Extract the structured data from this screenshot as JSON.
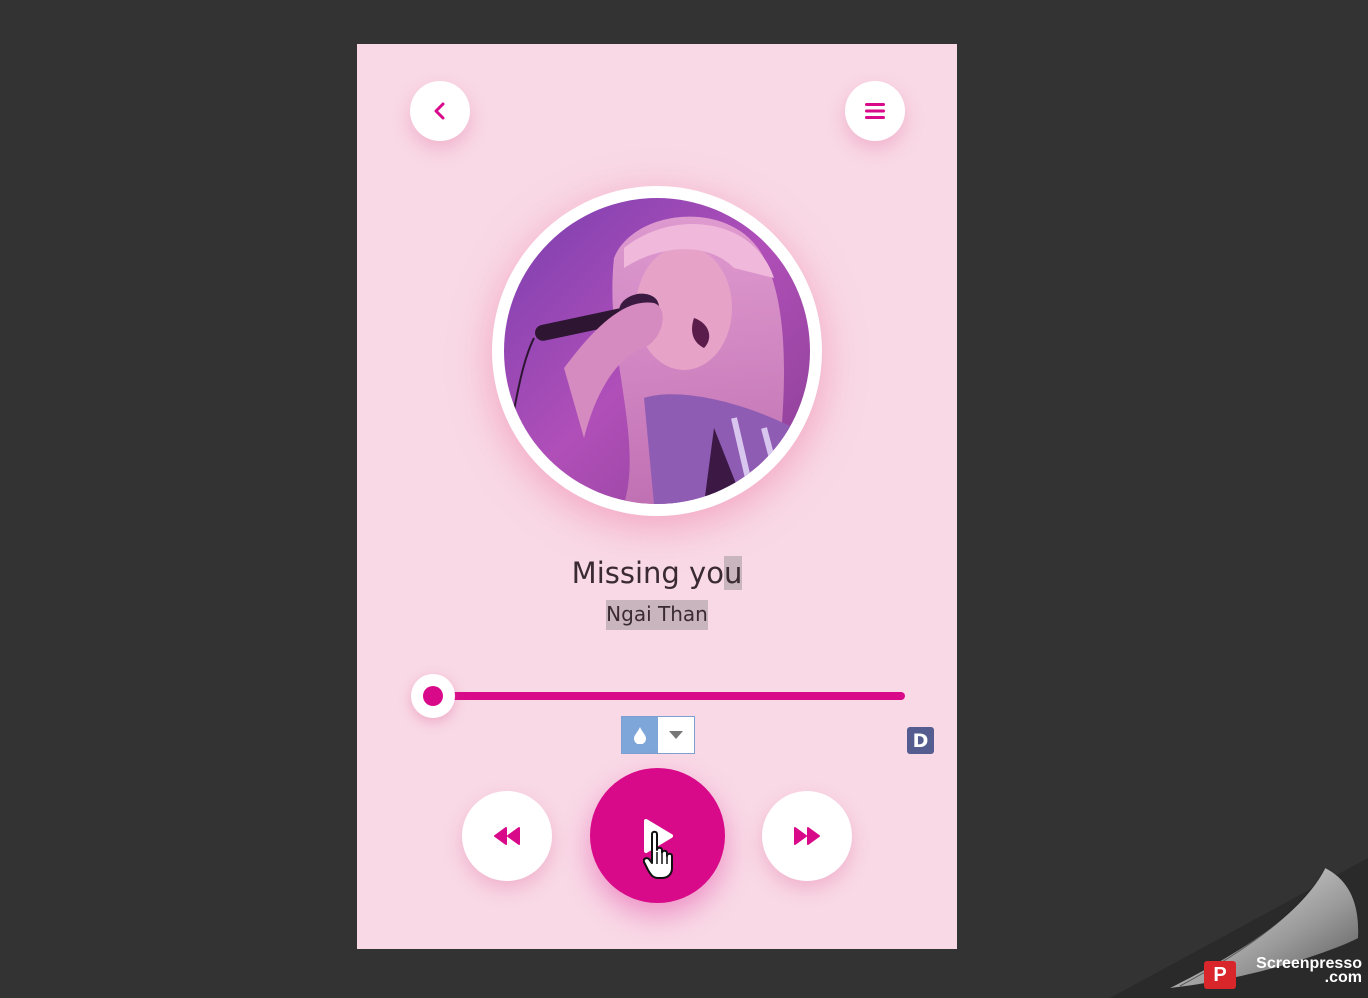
{
  "song": {
    "title_main": "Missing yo",
    "title_highlight": "u",
    "artist": "Ngai Than"
  },
  "progress": {
    "value": 0.0
  },
  "extension": {
    "badge_label": "D",
    "icon_left": "drop-icon",
    "icon_right": "caret-down-icon"
  },
  "controls": {
    "back_icon": "chevron-left-icon",
    "menu_icon": "hamburger-icon",
    "rewind_icon": "rewind-icon",
    "play_icon": "play-icon",
    "forward_icon": "fast-forward-icon"
  },
  "colors": {
    "accent": "#d80a8a",
    "background": "#f9d9e6",
    "desktop": "#333333"
  },
  "watermark": {
    "line1": "Screenpresso",
    "line2": ".com"
  }
}
